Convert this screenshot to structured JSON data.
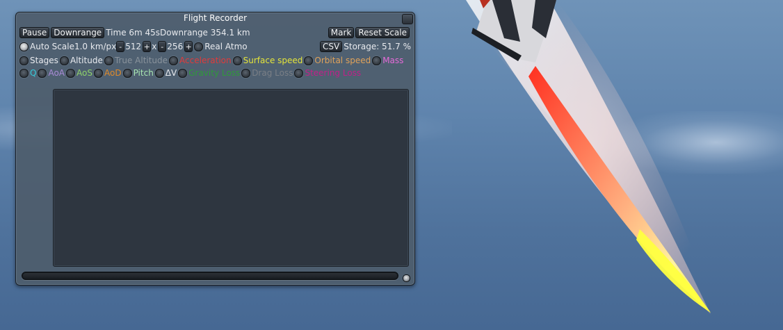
{
  "window": {
    "title": "Flight Recorder"
  },
  "toolbar": {
    "pause_label": "Pause",
    "downrange_label": "Downrange",
    "time_text": "Time 6m 45s",
    "downrange_text": "Downrange 354.1 km",
    "mark_label": "Mark",
    "reset_scale_label": "Reset Scale"
  },
  "scale_row": {
    "auto_scale_label": "Auto Scale",
    "auto_scale_on": true,
    "km_per_px": "1.0 km/px",
    "minus_label": "-",
    "plus_label": "+",
    "width_value": "512",
    "x_sep": "x",
    "height_value": "256",
    "real_atmo_label": "Real Atmo",
    "csv_label": "CSV",
    "storage_text": "Storage: 51.7 %"
  },
  "graphs_row1": [
    {
      "label": "Stages",
      "color": "#e8eaee"
    },
    {
      "label": "Altitude",
      "color": "#e8eaee"
    },
    {
      "label": "True Altitude",
      "color": "#8a939c"
    },
    {
      "label": "Acceleration",
      "color": "#e23a3a"
    },
    {
      "label": "Surface speed",
      "color": "#e4e43a"
    },
    {
      "label": "Orbital speed",
      "color": "#e0a25a"
    },
    {
      "label": "Mass",
      "color": "#e66ad8"
    }
  ],
  "graphs_row2": [
    {
      "label": "Q",
      "color": "#35c9d8"
    },
    {
      "label": "AoA",
      "color": "#a98bd6"
    },
    {
      "label": "AoS",
      "color": "#8fd26a"
    },
    {
      "label": "AoD",
      "color": "#e08a2a"
    },
    {
      "label": "Pitch",
      "color": "#a8e6b0"
    },
    {
      "label": "ΔV",
      "color": "#e8eaee"
    },
    {
      "label": "Gravity Loss",
      "color": "#2f9a3a"
    },
    {
      "label": "Drag Loss",
      "color": "#7a7f86"
    },
    {
      "label": "Steering Loss",
      "color": "#c02088"
    }
  ]
}
